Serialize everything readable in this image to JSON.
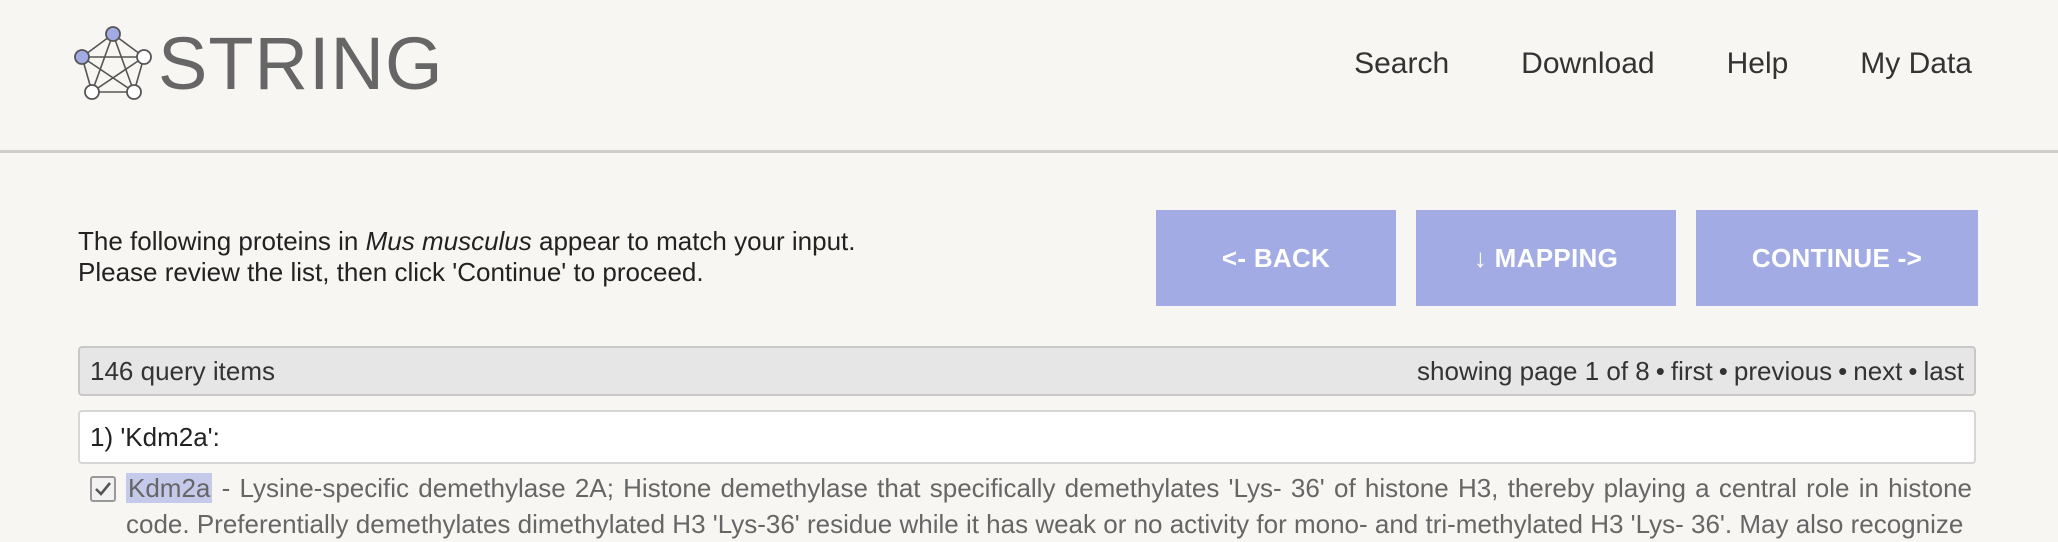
{
  "header": {
    "logo_text": "STRING",
    "nav": [
      "Search",
      "Download",
      "Help",
      "My Data"
    ]
  },
  "intro": {
    "line1_before": "The following proteins in ",
    "organism": "Mus musculus",
    "line1_after": " appear to match your input.",
    "line2": "Please review the list, then click 'Continue' to proceed."
  },
  "buttons": {
    "back": "<- BACK",
    "mapping": "↓ MAPPING",
    "continue": "CONTINUE ->"
  },
  "infobar": {
    "count": "146 query items",
    "showing": "showing page 1 of 8",
    "first": "first",
    "previous": "previous",
    "next": "next",
    "last": "last"
  },
  "query": {
    "label": "1) 'Kdm2a':"
  },
  "result": {
    "checked": true,
    "gene": "Kdm2a",
    "description": " - Lysine-specific demethylase 2A; Histone demethylase that specifically demethylates 'Lys- 36' of histone H3, thereby playing a central role in histone code. Preferentially demethylates dimethylated H3 'Lys-36' residue while it has weak or no activity for mono- and tri-methylated H3 'Lys- 36'. May also recognize"
  },
  "colors": {
    "button_bg": "#a2abe3",
    "highlight": "#c5c9ea",
    "background": "#f7f6f3"
  }
}
